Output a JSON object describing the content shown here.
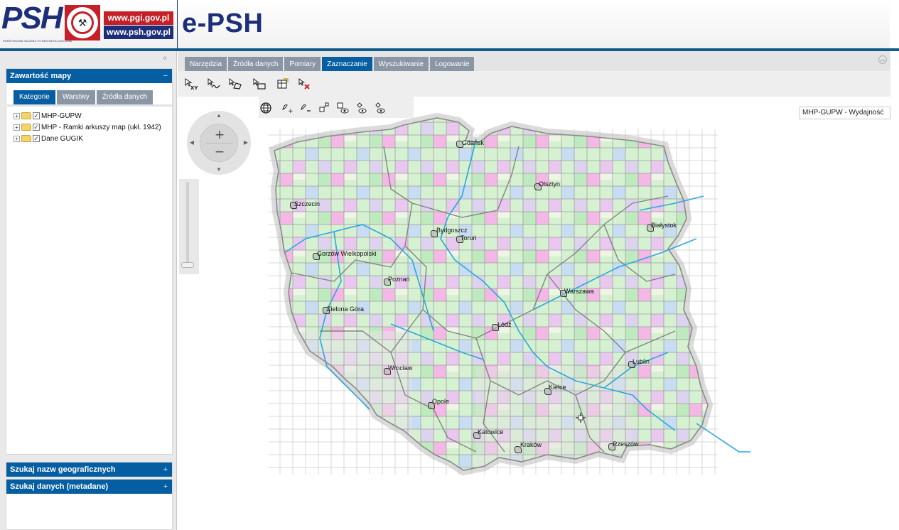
{
  "header": {
    "logo_text": "PSH",
    "logo_subtext": "PAŃSTWOWA SŁUŻBA HYDROGEOLOGICZNA",
    "url_pgi": "www.pgi.gov.pl",
    "url_psh": "www.psh.gov.pl",
    "app_title": "e-PSH"
  },
  "left_panel": {
    "collapse_glyph": "«",
    "map_contents": {
      "title": "Zawartość mapy",
      "toggle": "−",
      "tabs": [
        "Kategorie",
        "Warstwy",
        "Źródła danych"
      ],
      "tree": [
        {
          "label": "MHP-GUPW",
          "checked": true
        },
        {
          "label": "MHP - Ramki arkuszy map (ukł. 1942)",
          "checked": true
        },
        {
          "label": "Dane GUGIK",
          "checked": true
        }
      ]
    },
    "geo_search": {
      "title": "Szukaj nazw geograficznych",
      "toggle": "+"
    },
    "meta_search": {
      "title": "Szukaj danych (metadane)",
      "toggle": "+"
    }
  },
  "main_tabs": [
    "Narzędzia",
    "Źródła danych",
    "Pomiary",
    "Zaznaczanie",
    "Wyszukiwanie",
    "Logowanie"
  ],
  "active_main_tab": "Zaznaczanie",
  "toolbar": {
    "xy_label": "XY"
  },
  "map": {
    "layer_selector": "MHP-GUPW - Wydajność",
    "zoom_in": "+",
    "zoom_out": "−",
    "cities": [
      {
        "name": "Gdańsk"
      },
      {
        "name": "Olsztyn"
      },
      {
        "name": "Szczecin"
      },
      {
        "name": "Bydgoszcz"
      },
      {
        "name": "Toruń"
      },
      {
        "name": "Białystok"
      },
      {
        "name": "Gorzów Wielkopolski"
      },
      {
        "name": "Poznań"
      },
      {
        "name": "Warszawa"
      },
      {
        "name": "Zielona Góra"
      },
      {
        "name": "Łódź"
      },
      {
        "name": "Lublin"
      },
      {
        "name": "Wrocław"
      },
      {
        "name": "Kielce"
      },
      {
        "name": "Opole"
      },
      {
        "name": "Katowice"
      },
      {
        "name": "Kraków"
      },
      {
        "name": "Rzeszów"
      }
    ]
  },
  "colors": {
    "brand_blue": "#045ea1",
    "tab_grey": "#8a96a4",
    "logo_red": "#c52027",
    "logo_navy": "#1d2e7b"
  }
}
